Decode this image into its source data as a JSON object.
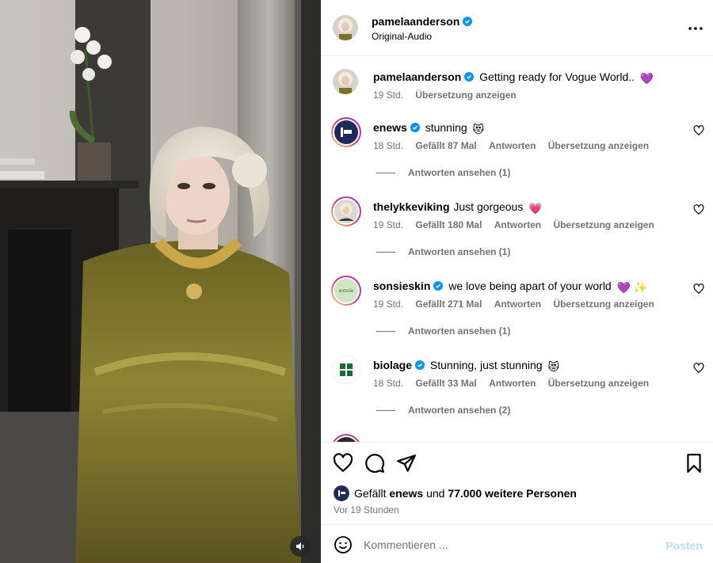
{
  "post": {
    "username": "pamelaanderson",
    "audio": "Original-Audio",
    "caption": "Getting ready for Vogue World..",
    "caption_emoji": "💜",
    "caption_time": "19 Std.",
    "translate_label": "Übersetzung anzeigen",
    "verified": true
  },
  "comments": [
    {
      "username": "enews",
      "verified": true,
      "text": "stunning",
      "emoji": "😻",
      "time": "18 Std.",
      "likes": "Gefällt 87 Mal",
      "reply_label": "Antworten",
      "translate_label": "Übersetzung anzeigen",
      "view_replies": "Antworten ansehen (1)",
      "avatar_icon": "enews-logo-icon"
    },
    {
      "username": "thelykkeviking",
      "verified": false,
      "text": "Just gorgeous",
      "emoji": "💗",
      "time": "19 Std.",
      "likes": "Gefällt 180 Mal",
      "reply_label": "Antworten",
      "translate_label": "Übersetzung anzeigen",
      "view_replies": "Antworten ansehen (1)",
      "avatar_icon": "portrait-avatar-icon"
    },
    {
      "username": "sonsieskin",
      "verified": true,
      "text": "we love being apart of your world",
      "emoji": "💜 ✨",
      "time": "19 Std.",
      "likes": "Gefällt 271 Mal",
      "reply_label": "Antworten",
      "translate_label": "Übersetzung anzeigen",
      "view_replies": "Antworten ansehen (1)",
      "avatar_icon": "sonsie-logo-icon",
      "avatar_text": "sonsie"
    },
    {
      "username": "biolage",
      "verified": true,
      "text": "Stunning, just stunning",
      "emoji": "😻",
      "time": "18 Std.",
      "likes": "Gefällt 33 Mal",
      "reply_label": "Antworten",
      "translate_label": "Übersetzung anzeigen",
      "view_replies": "Antworten ansehen (2)",
      "avatar_icon": "biolage-logo-icon"
    }
  ],
  "likes_summary": {
    "prefix": "Gefällt",
    "user": "enews",
    "middle": "und",
    "count": "77.000 weitere Personen"
  },
  "time_ago": "Vor 19 Stunden",
  "comment_box": {
    "placeholder": "Kommentieren ...",
    "post_label": "Posten"
  },
  "colors": {
    "verified": "#0095f6",
    "secondary_text": "#737373",
    "post_button_disabled": "#b2dffc",
    "story_ring_start": "#feda75",
    "story_ring_end": "#d62976"
  }
}
